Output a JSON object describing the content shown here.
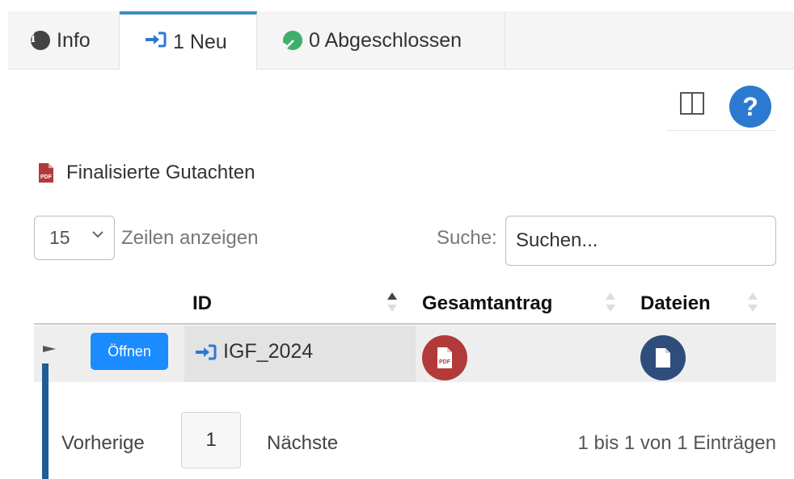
{
  "tabs": {
    "info_label": "Info",
    "new_label": "1 Neu",
    "done_label": "0 Abgeschlossen"
  },
  "toolbar": {
    "help_label": "?"
  },
  "heading": "Finalisierte Gutachten",
  "length": {
    "value": "15",
    "label": "Zeilen anzeigen"
  },
  "search": {
    "label": "Suche:",
    "placeholder": "Suchen..."
  },
  "table": {
    "columns": [
      "ID",
      "Gesamtantrag",
      "Dateien"
    ],
    "rows": [
      {
        "open_label": "Öffnen",
        "id": "IGF_2024",
        "gesamtantrag_icon": "pdf-icon",
        "dateien_icon": "file-icon"
      }
    ]
  },
  "pagination": {
    "prev": "Vorherige",
    "page": "1",
    "next": "Nächste",
    "info": "1 bis 1 von 1 Einträgen"
  },
  "colors": {
    "tab_accent": "#3c8dbc",
    "primary_button": "#1a8cff",
    "help": "#2c7ad0",
    "pdf": "#b23a3a",
    "file": "#2e4d7b",
    "success": "#3fae6a"
  },
  "icons": {
    "info_tab": "info-circle-icon",
    "new_tab": "sign-in-icon",
    "done_tab": "check-circle-icon",
    "columns": "columns-icon",
    "heading": "file-pdf-icon"
  }
}
